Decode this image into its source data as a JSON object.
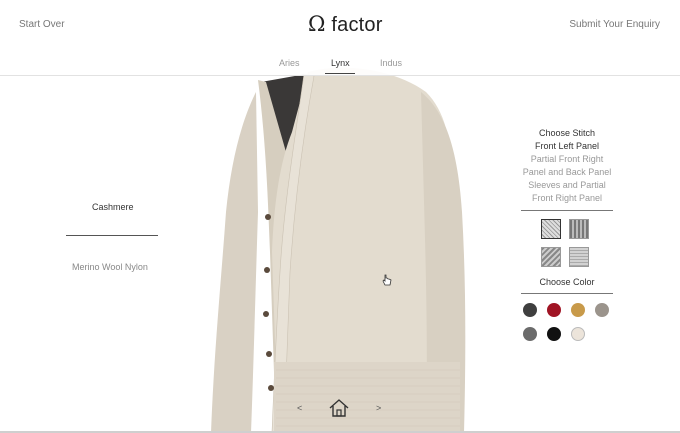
{
  "header": {
    "start_over": "Start Over",
    "submit": "Submit Your Enquiry",
    "logo_mark": "Ω",
    "logo_text": "factor"
  },
  "tabs": [
    {
      "label": "Aries",
      "active": false
    },
    {
      "label": "Lynx",
      "active": true
    },
    {
      "label": "Indus",
      "active": false
    }
  ],
  "materials": {
    "selected": "Cashmere",
    "other": "Merino Wool Nylon"
  },
  "stitch": {
    "title": "Choose Stitch",
    "selected_part": "Front Left Panel",
    "parts": [
      "Partial Front Right",
      "Panel and Back Panel",
      "Sleeves and Partial",
      "Front Right Panel"
    ]
  },
  "color": {
    "title": "Choose Color",
    "swatches": [
      "#3f3f3f",
      "#a01424",
      "#c89a4a",
      "#9b948c",
      "#6b6b6b",
      "#111111",
      "#ece4da"
    ]
  },
  "nav": {
    "prev": "<",
    "next": ">"
  },
  "garment": {
    "color": "#e3dccf"
  }
}
